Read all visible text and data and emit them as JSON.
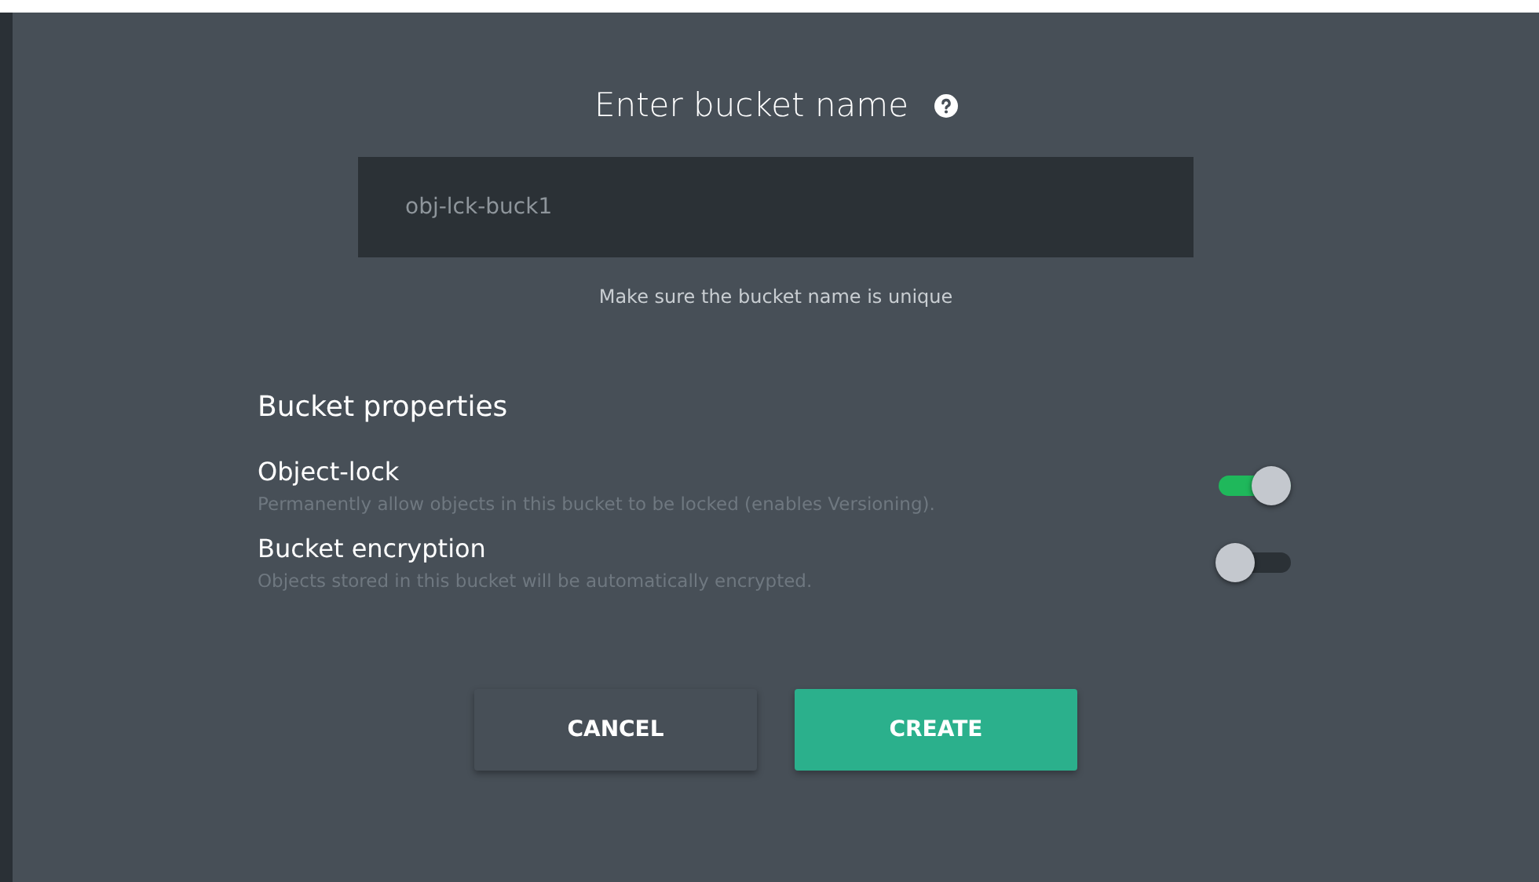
{
  "title": "Enter bucket name",
  "name_field": {
    "value": "obj-lck-buck1",
    "hint": "Make sure the bucket name is unique"
  },
  "properties": {
    "heading": "Bucket properties",
    "options": [
      {
        "label": "Object-lock",
        "description": "Permanently allow objects in this bucket to be locked (enables Versioning).",
        "on": true
      },
      {
        "label": "Bucket encryption",
        "description": "Objects stored in this bucket will be automatically encrypted.",
        "on": false
      }
    ]
  },
  "buttons": [
    {
      "label": "CANCEL",
      "kind": "secondary"
    },
    {
      "label": "CREATE",
      "kind": "primary"
    }
  ]
}
